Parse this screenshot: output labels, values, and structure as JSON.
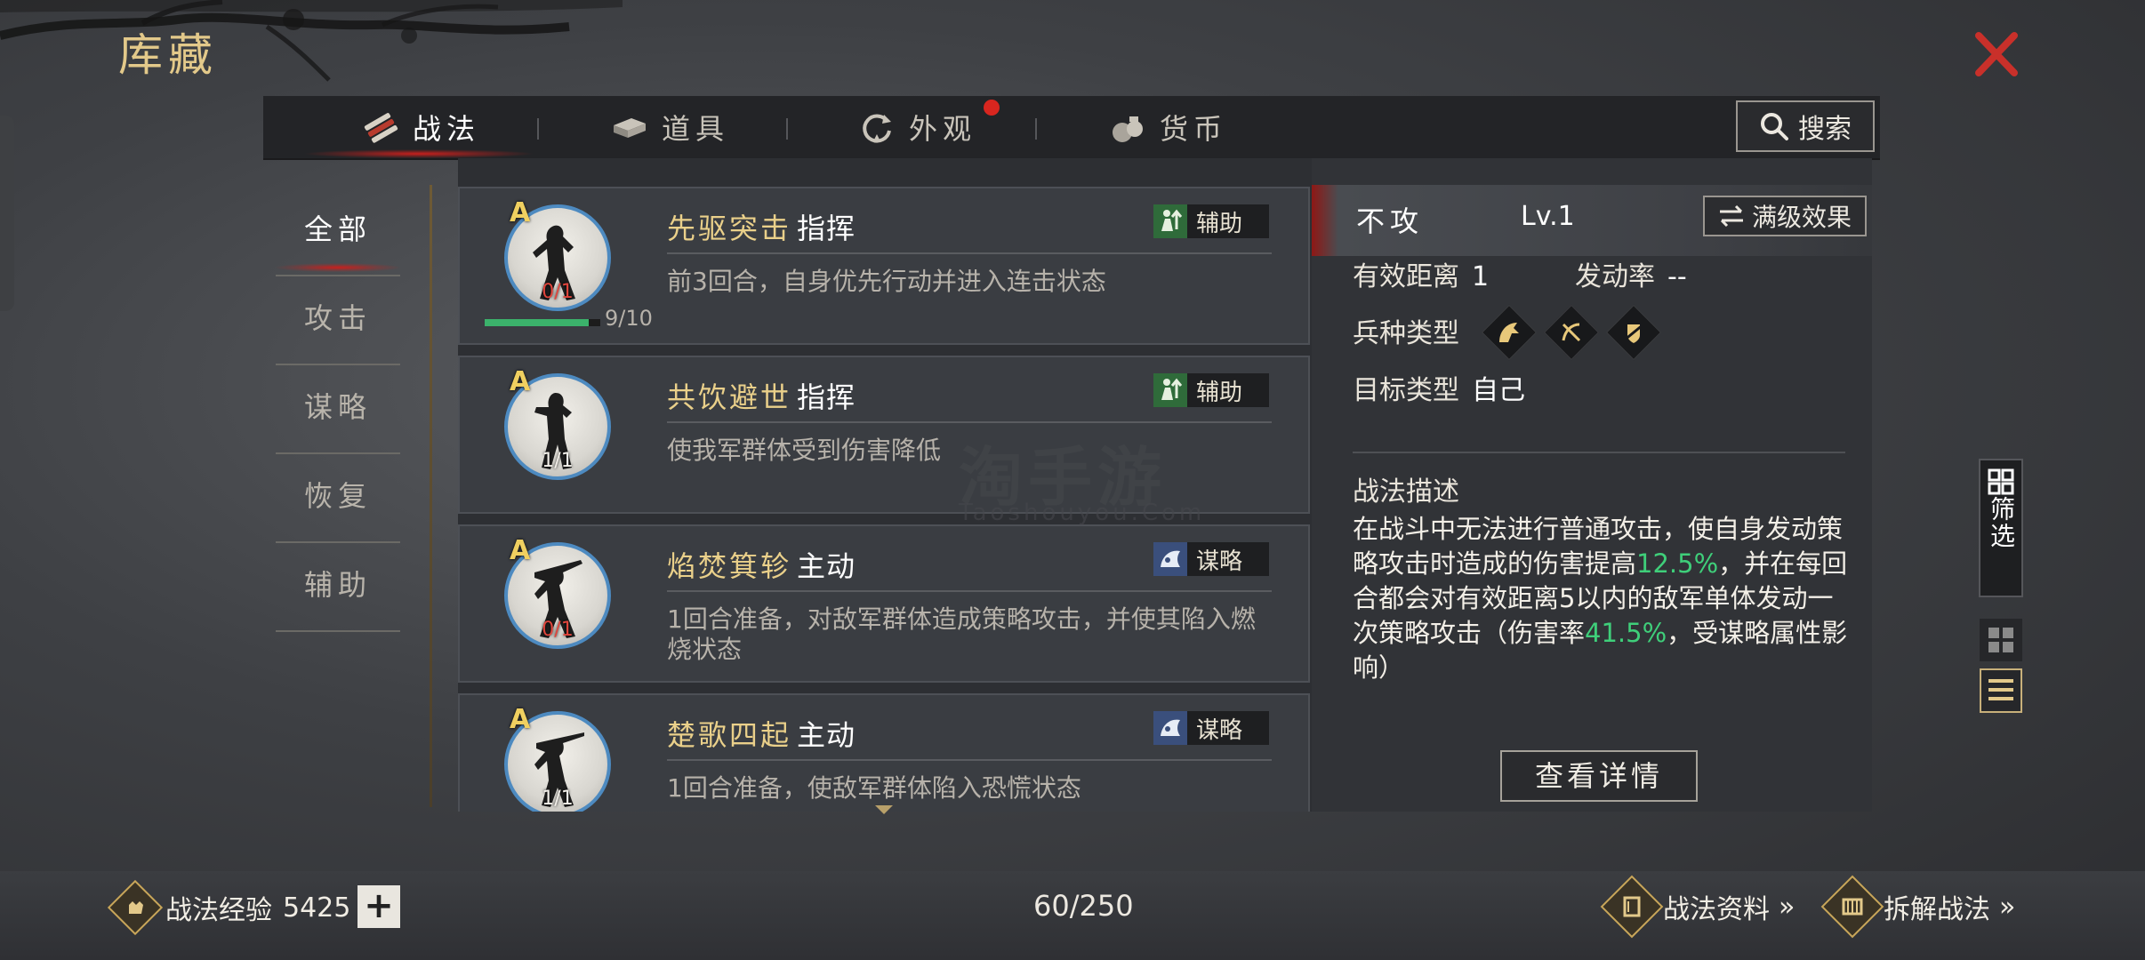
{
  "page": {
    "title": "库藏"
  },
  "tabs": [
    {
      "label": "战法",
      "icon": "scroll-bundle-icon",
      "active": true
    },
    {
      "label": "道具",
      "icon": "box-icon",
      "active": false
    },
    {
      "label": "外观",
      "icon": "refresh-icon",
      "active": false,
      "has_dot": true
    },
    {
      "label": "货币",
      "icon": "money-bag-icon",
      "active": false
    }
  ],
  "search": {
    "label": "搜索"
  },
  "side_nav": [
    {
      "label": "全部",
      "active": true
    },
    {
      "label": "攻击",
      "active": false
    },
    {
      "label": "谋略",
      "active": false
    },
    {
      "label": "恢复",
      "active": false
    },
    {
      "label": "辅助",
      "active": false
    }
  ],
  "skills": [
    {
      "grade": "A",
      "count": "0/1",
      "count_red": true,
      "name": "先驱突击",
      "ctype": "指挥",
      "badge": "辅助",
      "badge_icon": "support-icon",
      "desc": "前3回合，自身优先行动并进入连击状态",
      "xp": "9/10",
      "xp_fraction": 0.9
    },
    {
      "grade": "A",
      "count": "1/1",
      "count_red": false,
      "name": "共饮避世",
      "ctype": "指挥",
      "badge": "辅助",
      "badge_icon": "support-icon",
      "desc": "使我军群体受到伤害降低"
    },
    {
      "grade": "A",
      "count": "0/1",
      "count_red": true,
      "name": "焰焚箕轸",
      "ctype": "主动",
      "badge": "谋略",
      "badge_icon": "strategy-icon",
      "desc": "1回合准备，对敌军群体造成策略攻击，并使其陷入燃烧状态"
    },
    {
      "grade": "A",
      "count": "1/1",
      "count_red": false,
      "name": "楚歌四起",
      "ctype": "主动",
      "badge": "谋略",
      "badge_icon": "strategy-icon",
      "desc": "1回合准备，使敌军群体陷入恐慌状态"
    }
  ],
  "detail": {
    "title": "不攻",
    "level": "Lv.1",
    "max_btn": "满级效果",
    "range_label": "有效距离",
    "range_value": "1",
    "rate_label": "发动率",
    "rate_value": "--",
    "unit_label": "兵种类型",
    "target_label": "目标类型",
    "target_value": "自己",
    "desc_title": "战法描述",
    "desc_part1": "在战斗中无法进行普通攻击，使自身发动策略攻击时造成的伤害提高",
    "desc_hl1": "12.5%",
    "desc_part2": "，并在每回合都会对有效距离5以内的敌军单体发动一次策略攻击（伤害率",
    "desc_hl2": "41.5%",
    "desc_part3": "，受谋略属性影响）",
    "view_btn": "查看详情"
  },
  "filter": {
    "label": "筛选"
  },
  "bottom": {
    "exp_label": "战法经验",
    "exp_value": "5425",
    "plus": "+",
    "count": "60/250",
    "info_link": "战法资料",
    "dismantle_link": "拆解战法",
    "chevrons": "»"
  },
  "watermark": {
    "main": "淘手游",
    "sub": "Taoshouyou.Com"
  },
  "colors": {
    "gold": "#e3c98a",
    "highlight": "#3fcf7a",
    "accent_red": "#c8201d",
    "frame_blue": "#4d8ac0"
  }
}
